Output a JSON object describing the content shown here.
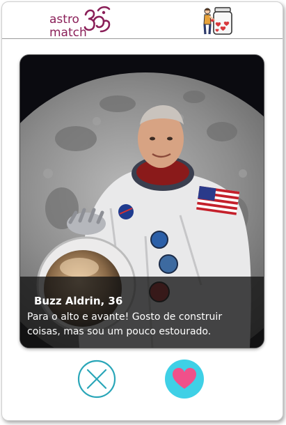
{
  "header": {
    "logo_word_1": "astro",
    "logo_word_2": "match",
    "logo_symbol_icon": "om-symbol-icon",
    "matches_icon": "jar-of-hearts-icon"
  },
  "profile": {
    "name_age": "Buzz Aldrin, 36",
    "bio": "Para o alto e avante! Gosto de construir coisas, mas sou um pouco estourado.",
    "photo_icon": "astronaut-portrait"
  },
  "actions": {
    "reject_icon": "x-icon",
    "like_icon": "heart-icon"
  },
  "colors": {
    "brand": "#8a1f58",
    "reject": "#2aa6b8",
    "like_circle": "#3fd0e6",
    "like_heart": "#f0508a"
  }
}
